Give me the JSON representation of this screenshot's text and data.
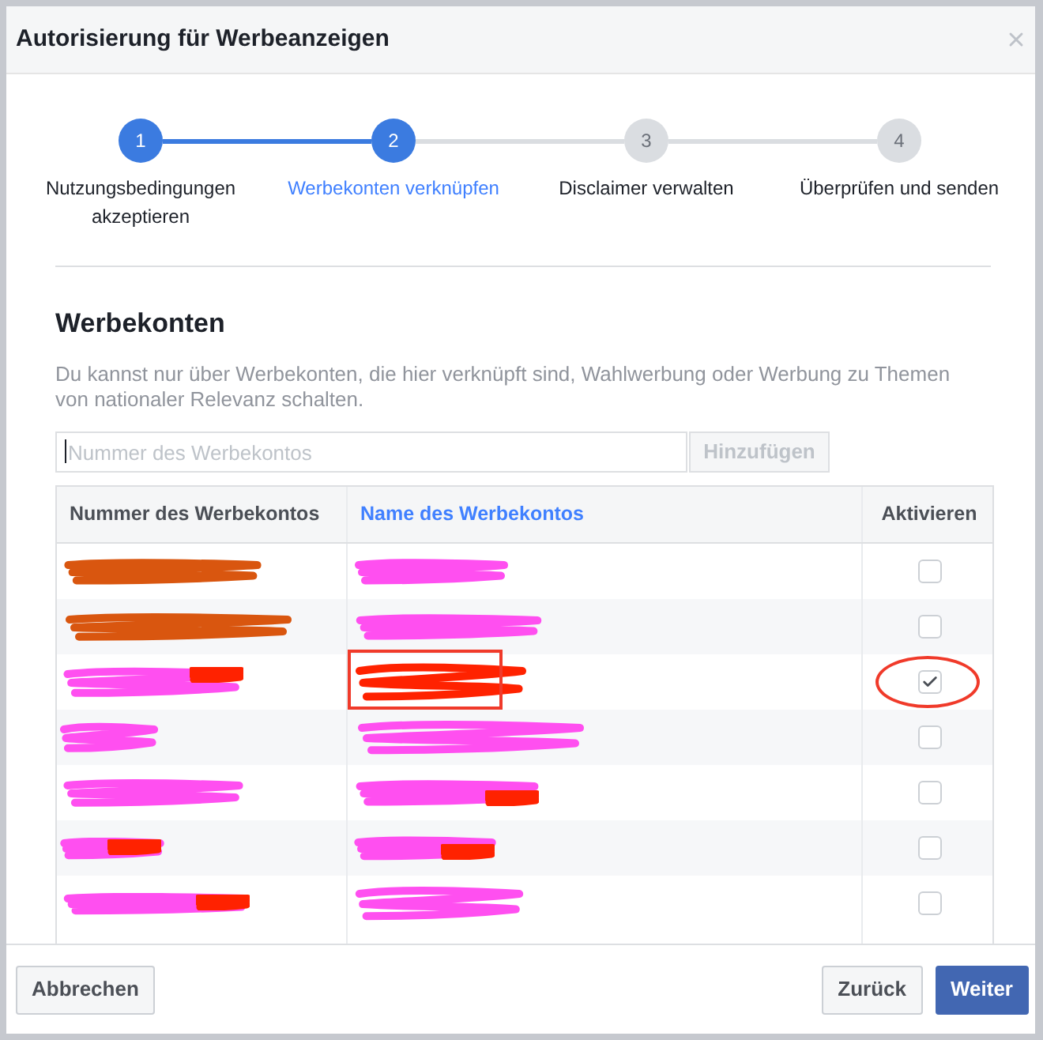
{
  "dialog": {
    "title": "Autorisierung für Werbeanzeigen"
  },
  "stepper": {
    "steps": [
      {
        "number": "1",
        "label": "Nutzungsbedingungen akzeptieren",
        "completed": true,
        "selected": false
      },
      {
        "number": "2",
        "label": "Werbekonten verknüpfen",
        "completed": false,
        "selected": true
      },
      {
        "number": "3",
        "label": "Disclaimer verwalten",
        "completed": false,
        "selected": false
      },
      {
        "number": "4",
        "label": "Überprüfen und senden",
        "completed": false,
        "selected": false
      }
    ]
  },
  "section": {
    "heading": "Werbekonten",
    "description": "Du kannst nur über Werbekonten, die hier verknüpft sind, Wahlwerbung oder Werbung zu Themen von nationaler Relevanz schalten."
  },
  "add_account": {
    "field": {
      "placeholder": "Nummer des Werbekontos",
      "focused": true
    },
    "button": {
      "label": "Hinzufügen",
      "disabled": true
    }
  },
  "table": {
    "columns": [
      {
        "label": "Nummer des Werbekontos",
        "sorted": false
      },
      {
        "label": "Name des Werbekontos",
        "sorted": true
      },
      {
        "label": "Aktivieren",
        "sorted": false
      }
    ],
    "rows": [
      {
        "number_marks": [
          {
            "color": "#d9560f"
          }
        ],
        "name_marks": [
          {
            "color": "#ff4ff0"
          }
        ],
        "checked": false,
        "annotated": false
      },
      {
        "number_marks": [
          {
            "color": "#d9560f"
          }
        ],
        "name_marks": [
          {
            "color": "#ff4ff0"
          }
        ],
        "checked": false,
        "annotated": false
      },
      {
        "number_marks": [
          {
            "color": "#ff4ff0"
          },
          {
            "color": "#ff2200"
          }
        ],
        "name_marks": [
          {
            "color": "#ff2200"
          }
        ],
        "checked": true,
        "annotated": true
      },
      {
        "number_marks": [
          {
            "color": "#ff4ff0"
          }
        ],
        "name_marks": [
          {
            "color": "#ff4ff0"
          }
        ],
        "checked": false,
        "annotated": false
      },
      {
        "number_marks": [
          {
            "color": "#ff4ff0"
          }
        ],
        "name_marks": [
          {
            "color": "#ff4ff0"
          },
          {
            "color": "#ff2200"
          }
        ],
        "checked": false,
        "annotated": false
      },
      {
        "number_marks": [
          {
            "color": "#ff4ff0"
          },
          {
            "color": "#ff2200"
          }
        ],
        "name_marks": [
          {
            "color": "#ff4ff0"
          },
          {
            "color": "#ff2200"
          }
        ],
        "checked": false,
        "annotated": false
      },
      {
        "number_marks": [
          {
            "color": "#ff4ff0"
          },
          {
            "color": "#ff2200"
          }
        ],
        "name_marks": [
          {
            "color": "#ff4ff0"
          }
        ],
        "checked": false,
        "annotated": false
      }
    ]
  },
  "footer": {
    "buttons": [
      {
        "label": "Abbrechen",
        "kind": "secondary"
      },
      {
        "label": "Zurück",
        "kind": "secondary"
      },
      {
        "label": "Weiter",
        "kind": "primary"
      }
    ]
  }
}
